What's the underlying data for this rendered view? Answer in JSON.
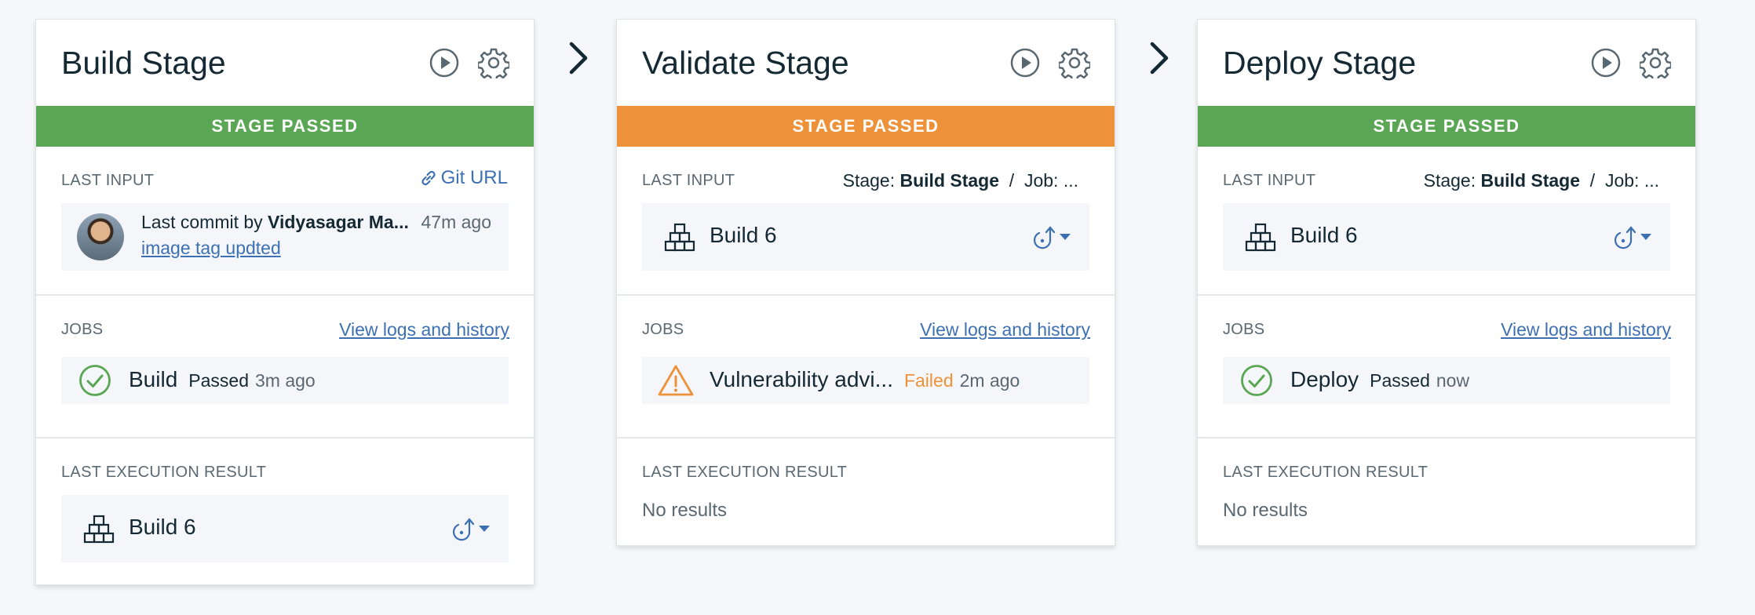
{
  "colors": {
    "passed_green": "#5aa655",
    "warning_orange": "#ee9239",
    "link_blue": "#3d70b2",
    "text_dark": "#152935",
    "text_muted": "#5a6872"
  },
  "stages": [
    {
      "title": "Build Stage",
      "status_label": "STAGE PASSED",
      "last_input_label": "LAST INPUT",
      "git_link_label": "Git URL",
      "commit": {
        "prefix": "Last commit by ",
        "author": "Vidyasagar Ma...",
        "time": "47m ago",
        "message": "image tag updted"
      },
      "jobs_label": "JOBS",
      "logs_link": "View logs and history",
      "job": {
        "name": "Build",
        "status": "Passed",
        "time": "3m ago",
        "icon": "check-circle-icon"
      },
      "exec_label": "LAST EXECUTION RESULT",
      "exec_artifact": "Build 6"
    },
    {
      "title": "Validate Stage",
      "status_label": "STAGE PASSED",
      "last_input_label": "LAST INPUT",
      "input_stage_prefix": "Stage: ",
      "input_stage_name": "Build Stage",
      "input_job_sep": "  /  Job: ...",
      "input_artifact": "Build 6",
      "jobs_label": "JOBS",
      "logs_link": "View logs and history",
      "job": {
        "name": "Vulnerability advi...",
        "status": "Failed",
        "time": "2m ago",
        "icon": "warning-triangle-icon"
      },
      "exec_label": "LAST EXECUTION RESULT",
      "exec_result": "No results"
    },
    {
      "title": "Deploy Stage",
      "status_label": "STAGE PASSED",
      "last_input_label": "LAST INPUT",
      "input_stage_prefix": "Stage: ",
      "input_stage_name": "Build Stage",
      "input_job_sep": "  /  Job: ...",
      "input_artifact": "Build 6",
      "jobs_label": "JOBS",
      "logs_link": "View logs and history",
      "job": {
        "name": "Deploy",
        "status": "Passed",
        "time": "now",
        "icon": "check-circle-icon"
      },
      "exec_label": "LAST EXECUTION RESULT",
      "exec_result": "No results"
    }
  ]
}
